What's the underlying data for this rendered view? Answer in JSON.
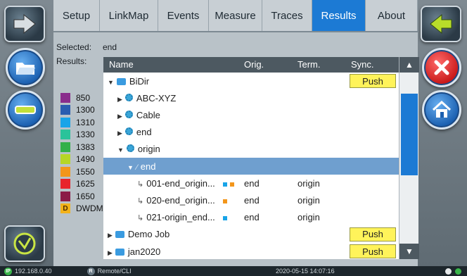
{
  "tabs": [
    "Setup",
    "LinkMap",
    "Events",
    "Measure",
    "Traces",
    "Results",
    "About"
  ],
  "active_tab": "Results",
  "selected_label": "Selected:",
  "selected_value": "end",
  "results_label": "Results:",
  "legend": [
    {
      "label": "850",
      "color": "#8a2d8c"
    },
    {
      "label": "1300",
      "color": "#2a5db0"
    },
    {
      "label": "1310",
      "color": "#18a4e8"
    },
    {
      "label": "1330",
      "color": "#2ac39a"
    },
    {
      "label": "1383",
      "color": "#33b049"
    },
    {
      "label": "1490",
      "color": "#b6d626"
    },
    {
      "label": "1550",
      "color": "#f3961b"
    },
    {
      "label": "1625",
      "color": "#e8232b"
    },
    {
      "label": "1650",
      "color": "#8b1a47"
    },
    {
      "label": "DWDM",
      "color": "#f2b21a",
      "badge": "D"
    }
  ],
  "columns": {
    "name": "Name",
    "orig": "Orig.",
    "term": "Term.",
    "sync": "Sync."
  },
  "rows": [
    {
      "name": "BiDir",
      "icon": "folder",
      "level": 0,
      "expanded": true,
      "sync": "Push"
    },
    {
      "name": "ABC-XYZ",
      "icon": "gear",
      "level": 1,
      "expanded": false
    },
    {
      "name": "Cable",
      "icon": "gear",
      "level": 1,
      "expanded": false
    },
    {
      "name": "end",
      "icon": "gear",
      "level": 1,
      "expanded": false
    },
    {
      "name": "origin",
      "icon": "gear",
      "level": 1,
      "expanded": true
    },
    {
      "name": "end",
      "icon": "link",
      "level": 2,
      "expanded": true,
      "selected": true
    },
    {
      "name": "001-end_origin...",
      "icon": "branch",
      "level": 3,
      "orig": "end",
      "term": "origin",
      "squares": [
        "#18a4e8",
        "#f3961b"
      ]
    },
    {
      "name": "020-end_origin...",
      "icon": "branch",
      "level": 3,
      "orig": "end",
      "term": "origin",
      "squares": [
        "#f3961b"
      ]
    },
    {
      "name": "021-origin_end...",
      "icon": "branch",
      "level": 3,
      "orig": "end",
      "term": "origin",
      "squares": [
        "#18a4e8"
      ]
    },
    {
      "name": "Demo Job",
      "icon": "folder",
      "level": 0,
      "expanded": false,
      "sync": "Push"
    },
    {
      "name": "jan2020",
      "icon": "folder",
      "level": 0,
      "expanded": false,
      "sync": "Push"
    }
  ],
  "status": {
    "ip_badge": "IP",
    "ip": "192.168.0.40",
    "remote_badge": "R",
    "remote": "Remote/CLI",
    "datetime": "2020-05-15  14:07:16"
  },
  "colors": {
    "accent": "#1c7ad4",
    "push": "#fff35a",
    "selected_row": "#6f9fcf"
  }
}
